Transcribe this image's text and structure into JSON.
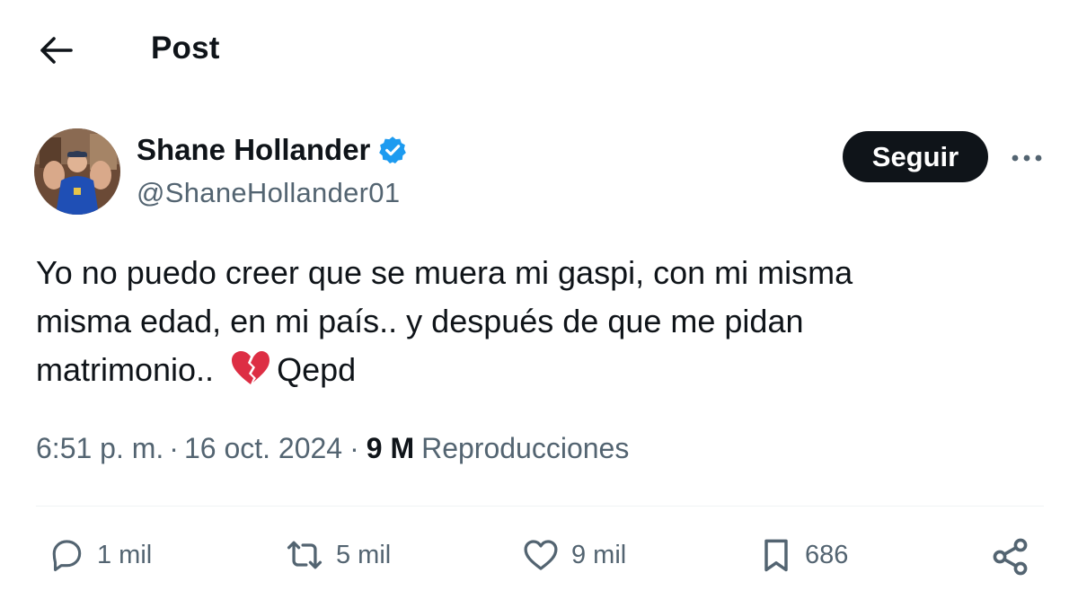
{
  "header": {
    "back_icon": "arrow-left-icon",
    "title": "Post"
  },
  "author": {
    "display_name": "Shane Hollander",
    "handle": "@ShaneHollander01",
    "verified_icon": "verified-badge-icon",
    "verified_color": "#1d9bf0"
  },
  "actions_top": {
    "follow_label": "Seguir",
    "more_icon": "more-horizontal-icon"
  },
  "tweet": {
    "lines": [
      "Yo no puedo creer que se muera mi gaspi, con mi misma",
      "misma edad, en mi país.. y después de que me pidan",
      "matrimonio.."
    ],
    "emoji": "💔",
    "suffix": "Qepd"
  },
  "meta": {
    "time": "6:51 p. m.",
    "separator": "·",
    "date": "16 oct. 2024",
    "views_count": "9 M",
    "views_label": "Reproducciones"
  },
  "engagement": {
    "replies": {
      "icon": "reply-icon",
      "count": "1 mil"
    },
    "reposts": {
      "icon": "repost-icon",
      "count": "5 mil"
    },
    "likes": {
      "icon": "heart-icon",
      "count": "9 mil"
    },
    "bookmarks": {
      "icon": "bookmark-icon",
      "count": "686"
    },
    "share": {
      "icon": "share-icon"
    }
  },
  "colors": {
    "text_primary": "#0f1419",
    "text_secondary": "#536471",
    "accent": "#1d9bf0",
    "divider": "#eff3f4",
    "heart_broken": "#e0245e"
  }
}
